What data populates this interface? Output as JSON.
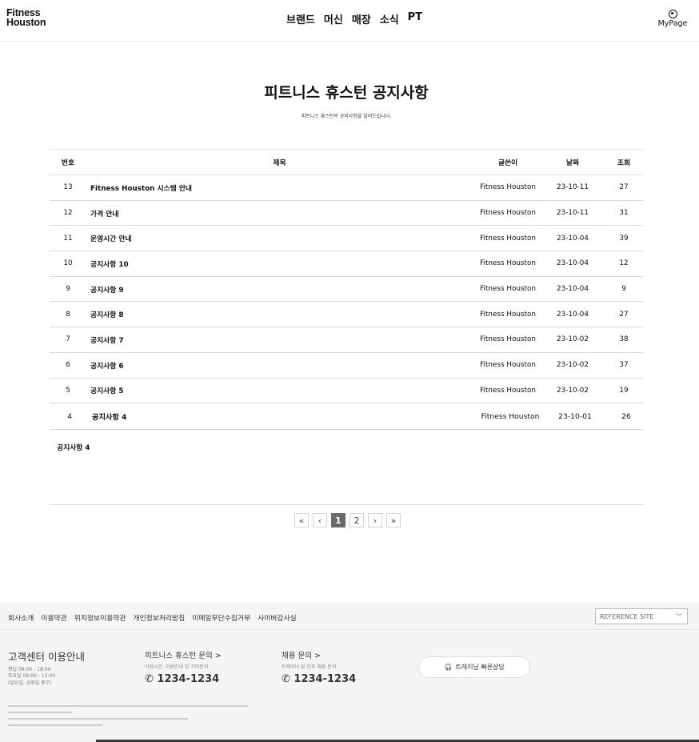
{
  "header": {
    "logo": [
      "Fitness",
      "Houston"
    ],
    "nav": [
      "브랜드",
      "머신",
      "매장",
      "소식",
      "PT"
    ],
    "mypage_label": "MyPage"
  },
  "page": {
    "title": "피트니스 휴스턴 공지사항",
    "subtitle": "피트니스 휴스턴의 공지사항을 알려드립니다."
  },
  "table": {
    "headers": [
      "번호",
      "제목",
      "글쓴이",
      "날짜",
      "조회"
    ],
    "rows": [
      {
        "no": "13",
        "subject": "Fitness Houston 시스템 안내",
        "author": "Fitness Houston",
        "date": "23-10-11",
        "views": "27"
      },
      {
        "no": "12",
        "subject": "가격 안내",
        "author": "Fitness Houston",
        "date": "23-10-11",
        "views": "31"
      },
      {
        "no": "11",
        "subject": "운영시간 안내",
        "author": "Fitness Houston",
        "date": "23-10-04",
        "views": "39"
      },
      {
        "no": "10",
        "subject": "공지사항 10",
        "author": "Fitness Houston",
        "date": "23-10-04",
        "views": "12"
      },
      {
        "no": "9",
        "subject": "공지사항 9",
        "author": "Fitness Houston",
        "date": "23-10-04",
        "views": "9"
      },
      {
        "no": "8",
        "subject": "공지사항 8",
        "author": "Fitness Houston",
        "date": "23-10-04",
        "views": "27"
      },
      {
        "no": "7",
        "subject": "공지사항 7",
        "author": "Fitness Houston",
        "date": "23-10-02",
        "views": "38"
      },
      {
        "no": "6",
        "subject": "공지사항 6",
        "author": "Fitness Houston",
        "date": "23-10-02",
        "views": "37"
      },
      {
        "no": "5",
        "subject": "공지사항 5",
        "author": "Fitness Houston",
        "date": "23-10-02",
        "views": "19"
      },
      {
        "no": "4",
        "subject": "공지사항 4",
        "author": "Fitness Houston",
        "date": "23-10-01",
        "views": "26"
      }
    ],
    "expanded_content": "공지사항 4"
  },
  "pagination": {
    "first": "«",
    "prev": "‹",
    "pages": [
      "1",
      "2"
    ],
    "current": "1",
    "next": "›",
    "last": "»"
  },
  "footer": {
    "links": [
      "회사소개",
      "이용약관",
      "위치정보이용약관",
      "개인정보처리방침",
      "이메일무단수집거부",
      "사이버감사실"
    ],
    "reference_site": "REFERENCE SITE",
    "customer_center": {
      "title": "고객센터 이용안내",
      "lines": [
        "평일 09:00 - 18:00",
        "토요일 09:00 - 13:00",
        "(일요일, 공휴일 휴무)"
      ]
    },
    "inquiry_fitness": {
      "title": "피트니스 휴스턴 문의 >",
      "sub": "이용시간, 이용안내 및 기타문의",
      "phone": "1234-1234"
    },
    "inquiry_recruit": {
      "title": "채용 문의 >",
      "sub": "트레이너 및 인포 채용 문의",
      "phone": "1234-1234"
    },
    "quick_consult": "트레이닝 빠른상담"
  },
  "colors": {
    "active_page": "#6a6a6a",
    "footer_bg": "#f5f5f5"
  }
}
